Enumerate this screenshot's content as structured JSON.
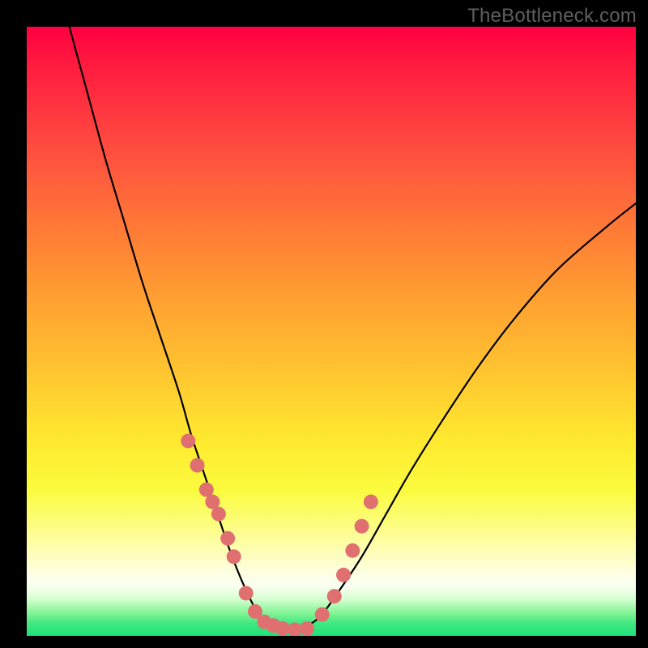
{
  "watermark": "TheBottleneck.com",
  "chart_data": {
    "type": "line",
    "title": "",
    "xlabel": "",
    "ylabel": "",
    "xlim": [
      0,
      100
    ],
    "ylim": [
      0,
      100
    ],
    "grid": false,
    "legend": false,
    "series": [
      {
        "name": "bottleneck-curve",
        "color": "#000000",
        "x": [
          7,
          10,
          13,
          16,
          19,
          22,
          25,
          27,
          29,
          31,
          33,
          34.5,
          36,
          37.5,
          39,
          41,
          43,
          45,
          48,
          51,
          55,
          59,
          63,
          68,
          74,
          80,
          87,
          95,
          100
        ],
        "y": [
          100,
          89,
          78,
          68,
          58,
          49,
          40,
          33,
          27,
          21,
          15,
          11,
          7.5,
          4.5,
          2.5,
          1.2,
          1.0,
          1.2,
          3.0,
          7,
          13,
          20,
          27,
          35,
          44,
          52,
          60,
          67,
          71
        ]
      },
      {
        "name": "highlight-markers",
        "color": "#e07070",
        "type": "scatter",
        "x": [
          26.5,
          28,
          29.5,
          30.5,
          31.5,
          33,
          34,
          36,
          37.5,
          39,
          40.5,
          42,
          44,
          46,
          48.5,
          50.5,
          52,
          53.5,
          55,
          56.5
        ],
        "y": [
          32,
          28,
          24,
          22,
          20,
          16,
          13,
          7,
          4,
          2.3,
          1.7,
          1.2,
          1.0,
          1.2,
          3.5,
          6.5,
          10,
          14,
          18,
          22
        ]
      }
    ],
    "background_gradient": {
      "orientation": "vertical",
      "stops": [
        {
          "pos": 0,
          "color": "#ff0040"
        },
        {
          "pos": 35,
          "color": "#ff8035"
        },
        {
          "pos": 68,
          "color": "#ffe92f"
        },
        {
          "pos": 90,
          "color": "#ffffe7"
        },
        {
          "pos": 100,
          "color": "#1ee27a"
        }
      ]
    }
  }
}
